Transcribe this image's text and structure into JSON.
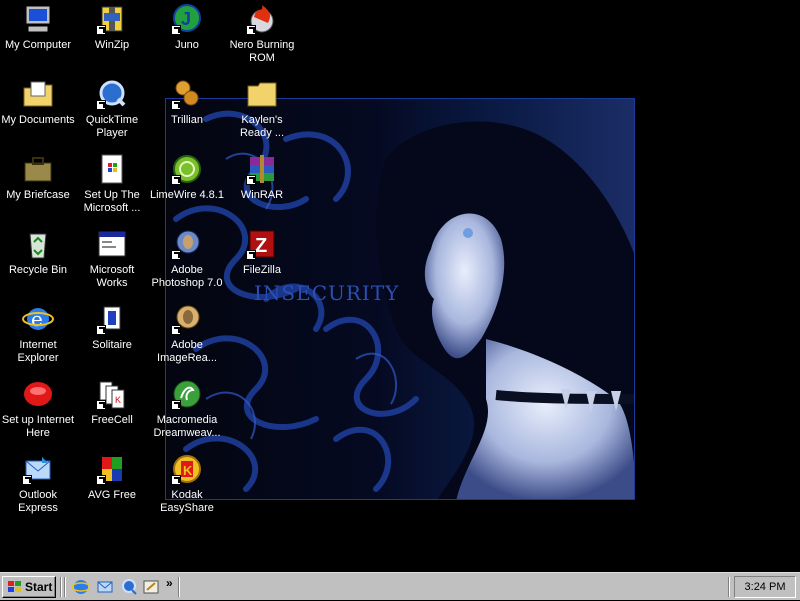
{
  "wallpaper": {
    "title": "INSECURITY"
  },
  "desktop_icons": [
    {
      "label": "My Computer",
      "icon": "my-computer-icon"
    },
    {
      "label": "My Documents",
      "icon": "my-documents-icon"
    },
    {
      "label": "My Briefcase",
      "icon": "briefcase-icon"
    },
    {
      "label": "Recycle Bin",
      "icon": "recycle-bin-icon"
    },
    {
      "label": "Internet Explorer",
      "icon": "internet-explorer-icon"
    },
    {
      "label": "Set up Internet Here",
      "icon": "setup-internet-icon"
    },
    {
      "label": "Outlook Express",
      "icon": "outlook-express-icon"
    },
    {
      "label": "WinZip",
      "icon": "winzip-icon"
    },
    {
      "label": "QuickTime Player",
      "icon": "quicktime-icon"
    },
    {
      "label": "Set Up The Microsoft ...",
      "icon": "setup-microsoft-icon"
    },
    {
      "label": "Microsoft Works",
      "icon": "microsoft-works-icon"
    },
    {
      "label": "Solitaire",
      "icon": "solitaire-icon"
    },
    {
      "label": "FreeCell",
      "icon": "freecell-icon"
    },
    {
      "label": "AVG Free",
      "icon": "avg-icon"
    },
    {
      "label": "Juno",
      "icon": "juno-icon"
    },
    {
      "label": "Trillian",
      "icon": "trillian-icon"
    },
    {
      "label": "LimeWire 4.8.1",
      "icon": "limewire-icon"
    },
    {
      "label": "Adobe Photoshop 7.0",
      "icon": "photoshop-icon"
    },
    {
      "label": "Adobe ImageRea...",
      "icon": "imageready-icon"
    },
    {
      "label": "Macromedia Dreamweav...",
      "icon": "dreamweaver-icon"
    },
    {
      "label": "Kodak EasyShare",
      "icon": "kodak-icon"
    },
    {
      "label": "Nero Burning ROM",
      "icon": "nero-icon"
    },
    {
      "label": "Kaylen's Ready ...",
      "icon": "folder-icon"
    },
    {
      "label": "WinRAR",
      "icon": "winrar-icon"
    },
    {
      "label": "FileZilla",
      "icon": "filezilla-icon"
    }
  ],
  "taskbar": {
    "start_label": "Start",
    "quick_launch": [
      "internet-explorer-icon",
      "outlook-express-icon",
      "quicktime-icon",
      "show-desktop-icon"
    ],
    "chevron": "»",
    "clock": "3:24 PM"
  }
}
